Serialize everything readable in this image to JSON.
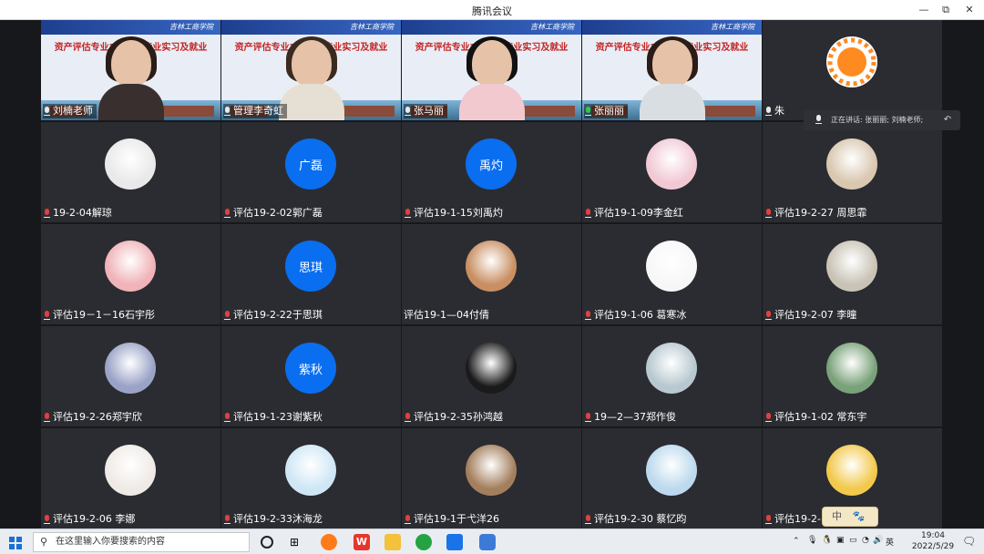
{
  "window": {
    "title": "腾讯会议",
    "min_glyph": "—",
    "restore_glyph": "⧉",
    "close_glyph": "✕"
  },
  "slide": {
    "school": "吉林工商学院",
    "title_line1": "资产评估专业2019级毕业实习及就业",
    "title_line2": "动员会",
    "date": "2022年5月29日"
  },
  "video_tiles": [
    {
      "name": "刘楠老师",
      "mic": "normal",
      "shirt": "#3a2f2f",
      "hair": "#2a1c16"
    },
    {
      "name": "管理李奇虹",
      "mic": "normal",
      "shirt": "#e6dfd4",
      "hair": "#3a2a20"
    },
    {
      "name": "张马丽",
      "mic": "normal",
      "shirt": "#f2c9cf",
      "hair": "#111111"
    },
    {
      "name": "张丽丽",
      "mic": "active",
      "shirt": "#d9dee2",
      "hair": "#2a1c16"
    }
  ],
  "host_tile": {
    "name": "朱",
    "avatar": "sun-avatar",
    "avatar_color": "#ff8a1f"
  },
  "speaking_now": "正在讲话: 张丽丽; 刘楠老师;",
  "participants": [
    {
      "name": "19-2-04解琼",
      "avatar": "image",
      "avatar_color": "#e9e9e9"
    },
    {
      "name": "评估19-2-02郭广磊",
      "avatar": "text",
      "avatar_text": "广磊"
    },
    {
      "name": "评估19-1-15刘禹灼",
      "avatar": "text",
      "avatar_text": "禹灼"
    },
    {
      "name": "评估19-1-09李金红",
      "avatar": "image",
      "avatar_color": "#f1c9d5"
    },
    {
      "name": "评估19-2-27 周思霏",
      "avatar": "image",
      "avatar_color": "#d9c7b0"
    },
    {
      "name": "评估19－1－16石宇彤",
      "avatar": "image",
      "avatar_color": "#f0b3b8"
    },
    {
      "name": "评估19-2-22于思琪",
      "avatar": "text",
      "avatar_text": "思琪"
    },
    {
      "name": "评估19-1—04付倩",
      "avatar": "image",
      "avatar_color": "#c98f63",
      "no_mic": true
    },
    {
      "name": "评估19-1-06 葛寒冰",
      "avatar": "image",
      "avatar_color": "#f7f7f7"
    },
    {
      "name": "评估19-2-07 李曈",
      "avatar": "image",
      "avatar_color": "#c9c3b5"
    },
    {
      "name": "评估19-2-26郑宇欣",
      "avatar": "image",
      "avatar_color": "#9aa3c7"
    },
    {
      "name": "评估19-1-23谢紫秋",
      "avatar": "text",
      "avatar_text": "紫秋"
    },
    {
      "name": "评估19-2-35孙鸿越",
      "avatar": "image",
      "avatar_color": "#1a1a1a"
    },
    {
      "name": "19—2—37郑作俊",
      "avatar": "image",
      "avatar_color": "#b8c8d0"
    },
    {
      "name": "评估19-1-02 常东宇",
      "avatar": "image",
      "avatar_color": "#7aa27a"
    },
    {
      "name": "评估19-2-06 李娜",
      "avatar": "image",
      "avatar_color": "#efeae6"
    },
    {
      "name": "评估19-2-33沐海龙",
      "avatar": "image",
      "avatar_color": "#cfe7f5"
    },
    {
      "name": "评估19-1于弋洋26",
      "avatar": "image",
      "avatar_color": "#a47f5d"
    },
    {
      "name": "评估19-2-30 蔡忆昀",
      "avatar": "image",
      "avatar_color": "#bcd9ee"
    },
    {
      "name": "评估19-2-",
      "avatar": "image",
      "avatar_color": "#f2c94c"
    }
  ],
  "ime": {
    "label": "中"
  },
  "taskbar": {
    "search_placeholder": "在这里输入你要搜索的内容",
    "time": "19:04",
    "date": "2022/5/29",
    "ime_tray": "英"
  }
}
